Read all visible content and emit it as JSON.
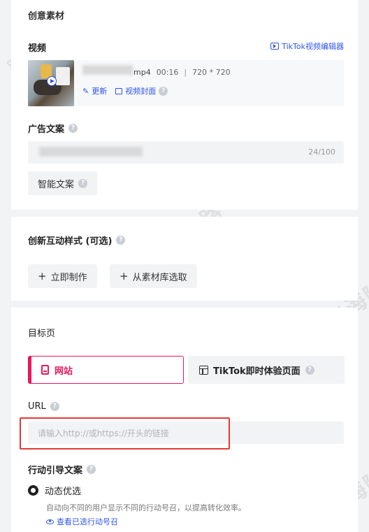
{
  "creative": {
    "title": "创意素材",
    "video_label": "视频",
    "tiktok_editor_link": "TikTok视频编辑器",
    "file_suffix": "mp4",
    "duration": "00:16",
    "separator": "|",
    "resolution": "720 * 720",
    "update_link": "更新",
    "cover_link": "视频封面"
  },
  "ad_copy": {
    "label": "广告文案",
    "counter": "24/100",
    "smart_button": "智能文案"
  },
  "interactive": {
    "label": "创新互动样式 (可选)",
    "make_now": "立即制作",
    "from_library": "从素材库选取",
    "plus": "+"
  },
  "target": {
    "label": "目标页",
    "tab_website": "网站",
    "tab_instant": "TikTok即时体验页面",
    "url_label": "URL",
    "url_placeholder": "请输入http://或https://开头的链接",
    "accent": "#e8175d",
    "highlight": "#e53935"
  },
  "cta": {
    "label": "行动引导文案",
    "option_dynamic": "动态优选",
    "description": "自动向不同的用户显示不同的行动号召，以提高转化效率。",
    "view_link": "查看已选行动号召"
  },
  "watermark": "跨境出海陆路"
}
